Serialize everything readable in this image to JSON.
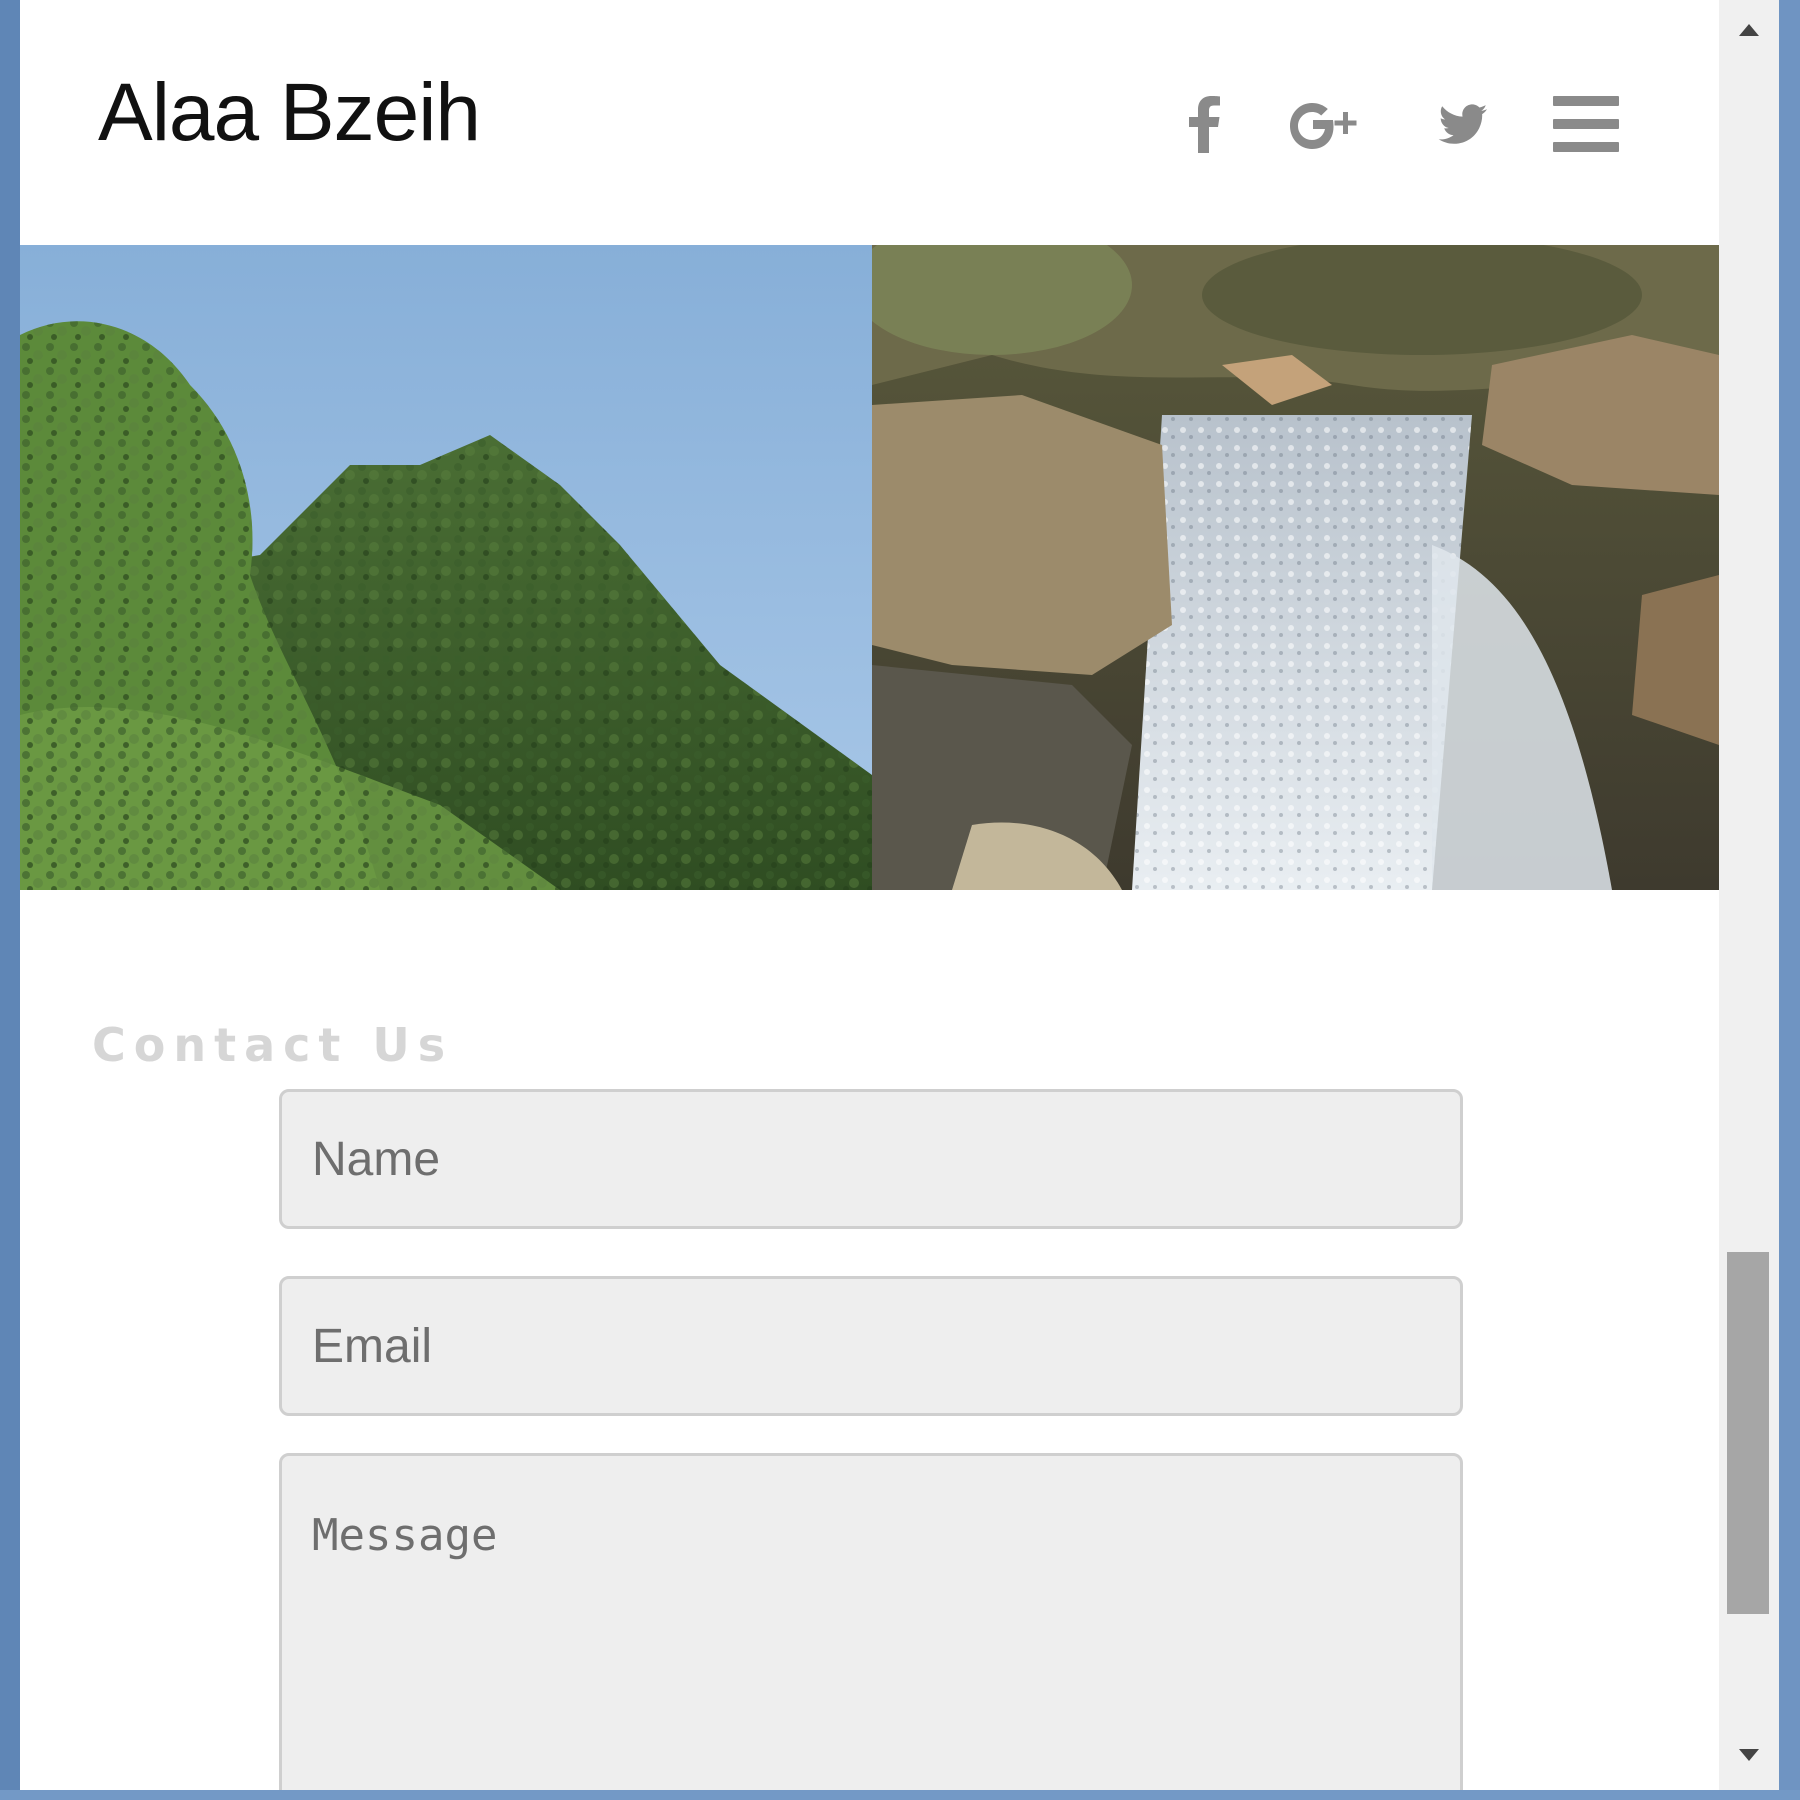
{
  "header": {
    "site_title": "Alaa Bzeih",
    "social_icons": [
      "facebook-icon",
      "google-plus-icon",
      "twitter-icon"
    ],
    "menu_icon": "hamburger-menu-icon"
  },
  "hero": {
    "images": [
      "mountain-photo",
      "waterfall-photo"
    ]
  },
  "contact": {
    "heading": "Contact Us",
    "name_placeholder": "Name",
    "email_placeholder": "Email",
    "message_placeholder": "Message"
  },
  "colors": {
    "icon_gray": "#8a8a8a",
    "field_bg": "#eeeeee",
    "heading_gray": "#d6d6d6",
    "window_frame": "#6f94c2"
  }
}
